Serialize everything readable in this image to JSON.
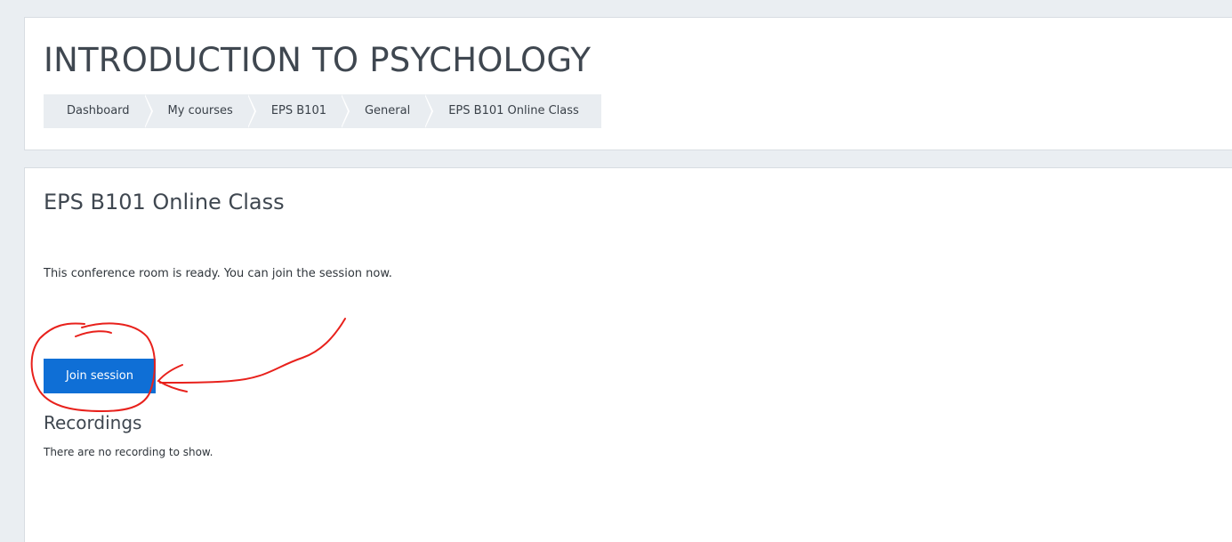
{
  "header": {
    "course_title": "INTRODUCTION TO PSYCHOLOGY",
    "breadcrumb": [
      {
        "label": "Dashboard"
      },
      {
        "label": "My courses"
      },
      {
        "label": "EPS B101"
      },
      {
        "label": "General"
      },
      {
        "label": "EPS B101 Online Class"
      }
    ]
  },
  "main": {
    "activity_title": "EPS B101 Online Class",
    "status_text": "This conference room is ready. You can join the session now.",
    "join_button_label": "Join session",
    "recordings_heading": "Recordings",
    "recordings_empty_text": "There are no recording to show."
  },
  "colors": {
    "primary_button": "#0f6fd6",
    "annotation_stroke": "#e8211c",
    "page_background": "#eaeef2"
  }
}
